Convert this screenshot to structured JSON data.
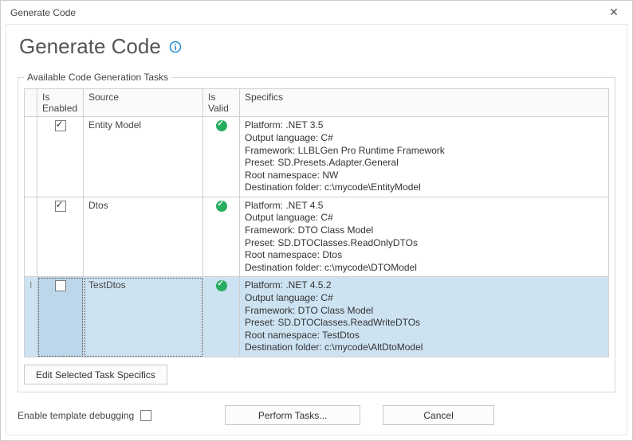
{
  "window": {
    "title": "Generate Code"
  },
  "heading": "Generate Code",
  "group": {
    "legend": "Available Code Generation Tasks"
  },
  "columns": {
    "is_enabled": "Is Enabled",
    "source": "Source",
    "is_valid": "Is Valid",
    "specifics": "Specifics"
  },
  "rows": [
    {
      "enabled": true,
      "source": "Entity Model",
      "valid": true,
      "selected": false,
      "cursor": false,
      "specifics": {
        "platform": "Platform: .NET 3.5",
        "lang": "Output language: C#",
        "framework": "Framework: LLBLGen Pro Runtime Framework",
        "preset": "Preset: SD.Presets.Adapter.General",
        "ns": "Root namespace: NW",
        "dest": "Destination folder: c:\\mycode\\EntityModel"
      }
    },
    {
      "enabled": true,
      "source": "Dtos",
      "valid": true,
      "selected": false,
      "cursor": false,
      "specifics": {
        "platform": "Platform: .NET 4.5",
        "lang": "Output language: C#",
        "framework": "Framework: DTO Class Model",
        "preset": "Preset: SD.DTOClasses.ReadOnlyDTOs",
        "ns": "Root namespace: Dtos",
        "dest": "Destination folder: c:\\mycode\\DTOModel"
      }
    },
    {
      "enabled": false,
      "source": "TestDtos",
      "valid": true,
      "selected": true,
      "cursor": true,
      "specifics": {
        "platform": "Platform: .NET 4.5.2",
        "lang": "Output language: C#",
        "framework": "Framework: DTO Class Model",
        "preset": "Preset: SD.DTOClasses.ReadWriteDTOs",
        "ns": "Root namespace: TestDtos",
        "dest": "Destination folder: c:\\mycode\\AltDtoModel"
      }
    }
  ],
  "buttons": {
    "edit_specifics": "Edit Selected Task Specifics",
    "perform": "Perform Tasks...",
    "cancel": "Cancel"
  },
  "footer": {
    "enable_debug_label": "Enable template debugging"
  }
}
